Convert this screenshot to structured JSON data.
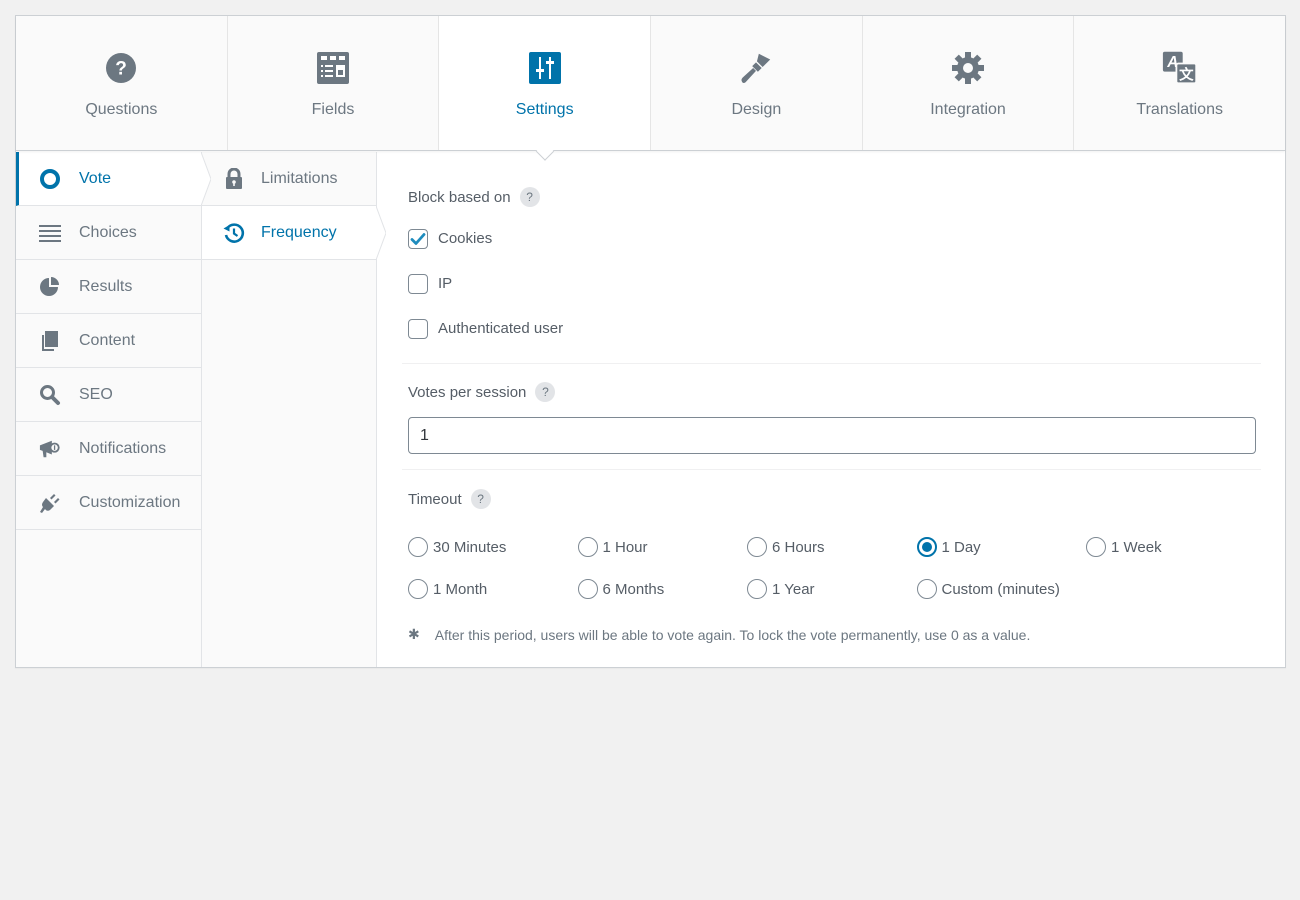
{
  "top_tabs": [
    {
      "label": "Questions",
      "icon": "question-circle-icon",
      "active": false
    },
    {
      "label": "Fields",
      "icon": "fields-form-icon",
      "active": false
    },
    {
      "label": "Settings",
      "icon": "sliders-icon",
      "active": true
    },
    {
      "label": "Design",
      "icon": "paintbrush-icon",
      "active": false
    },
    {
      "label": "Integration",
      "icon": "gear-icon",
      "active": false
    },
    {
      "label": "Translations",
      "icon": "translate-icon",
      "active": false
    }
  ],
  "sidebar": {
    "items": [
      {
        "label": "Vote",
        "icon": "circle-icon",
        "active": true
      },
      {
        "label": "Choices",
        "icon": "list-icon",
        "active": false
      },
      {
        "label": "Results",
        "icon": "pie-chart-icon",
        "active": false
      },
      {
        "label": "Content",
        "icon": "copy-icon",
        "active": false
      },
      {
        "label": "SEO",
        "icon": "search-icon",
        "active": false
      },
      {
        "label": "Notifications",
        "icon": "megaphone-icon",
        "active": false
      },
      {
        "label": "Customization",
        "icon": "plug-icon",
        "active": false
      }
    ]
  },
  "subnav": {
    "items": [
      {
        "label": "Limitations",
        "icon": "lock-icon",
        "active": false
      },
      {
        "label": "Frequency",
        "icon": "history-icon",
        "active": true
      }
    ]
  },
  "content": {
    "block_based_on": {
      "label": "Block based on",
      "help": "?",
      "options": [
        {
          "label": "Cookies",
          "checked": true
        },
        {
          "label": "IP",
          "checked": false
        },
        {
          "label": "Authenticated user",
          "checked": false
        }
      ]
    },
    "votes_per_session": {
      "label": "Votes per session",
      "help": "?",
      "value": "1"
    },
    "timeout": {
      "label": "Timeout",
      "help": "?",
      "selected": "1 Day",
      "options": [
        "30 Minutes",
        "1 Hour",
        "6 Hours",
        "1 Day",
        "1 Week",
        "1 Month",
        "6 Months",
        "1 Year",
        "Custom (minutes)"
      ],
      "note_marker": "✱",
      "note": "After this period, users will be able to vote again. To lock the vote permanently, use 0 as a value."
    }
  },
  "colors": {
    "accent": "#0073aa",
    "icon_gray": "#6c7781",
    "background": "#f1f1f1"
  }
}
